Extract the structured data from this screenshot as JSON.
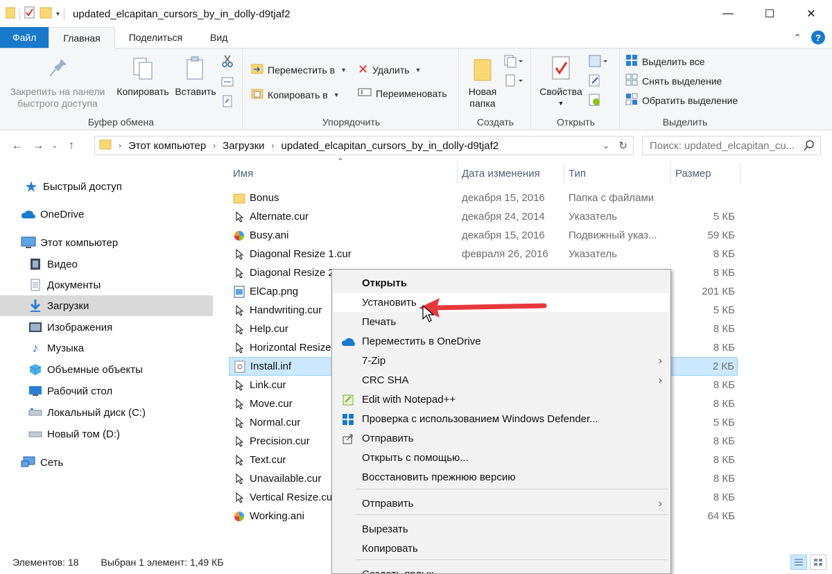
{
  "window": {
    "title": "updated_elcapitan_cursors_by_in_dolly-d9tjaf2",
    "buttons": {
      "minimize": "—",
      "maximize": "☐",
      "close": "✕"
    }
  },
  "ribbon_tabs": [
    "Файл",
    "Главная",
    "Поделиться",
    "Вид"
  ],
  "ribbon": {
    "clipboard": {
      "label": "Буфер обмена",
      "pin_line1": "Закрепить на панели",
      "pin_line2": "быстрого доступа",
      "copy": "Копировать",
      "paste": "Вставить"
    },
    "organize": {
      "label": "Упорядочить",
      "move_to": "Переместить в",
      "copy_to": "Копировать в",
      "delete": "Удалить",
      "rename": "Переименовать"
    },
    "new": {
      "label": "Создать",
      "new_folder_line1": "Новая",
      "new_folder_line2": "папка"
    },
    "open": {
      "label": "Открыть",
      "properties": "Свойства"
    },
    "select": {
      "label": "Выделить",
      "select_all": "Выделить все",
      "select_none": "Снять выделение",
      "invert": "Обратить выделение"
    }
  },
  "address": {
    "crumbs": [
      "Этот компьютер",
      "Загрузки",
      "updated_elcapitan_cursors_by_in_dolly-d9tjaf2"
    ],
    "search_placeholder": "Поиск: updated_elcapitan_cu..."
  },
  "sidebar": [
    {
      "label": "Быстрый доступ",
      "icon": "star-icon"
    },
    {
      "label": "OneDrive",
      "icon": "cloud-icon"
    },
    {
      "label": "Этот компьютер",
      "icon": "computer-icon"
    },
    {
      "label": "Видео",
      "icon": "video-icon"
    },
    {
      "label": "Документы",
      "icon": "documents-icon"
    },
    {
      "label": "Загрузки",
      "icon": "download-icon",
      "selected": true
    },
    {
      "label": "Изображения",
      "icon": "pictures-icon"
    },
    {
      "label": "Музыка",
      "icon": "music-icon"
    },
    {
      "label": "Объемные объекты",
      "icon": "3d-objects-icon"
    },
    {
      "label": "Рабочий стол",
      "icon": "desktop-icon"
    },
    {
      "label": "Локальный диск (C:)",
      "icon": "drive-icon"
    },
    {
      "label": "Новый том (D:)",
      "icon": "drive-icon"
    },
    {
      "label": "Сеть",
      "icon": "network-icon"
    }
  ],
  "columns": {
    "name": "Имя",
    "date": "Дата изменения",
    "type": "Тип",
    "size": "Размер"
  },
  "files": [
    {
      "name": "Bonus",
      "date": "декабря 15, 2016",
      "type": "Папка с файлами",
      "size": "",
      "icon": "folder-icon"
    },
    {
      "name": "Alternate.cur",
      "date": "декабря 24, 2014",
      "type": "Указатель",
      "size": "5 КБ",
      "icon": "cursor-file-icon"
    },
    {
      "name": "Busy.ani",
      "date": "декабря 15, 2016",
      "type": "Подвижный указ...",
      "size": "59 КБ",
      "icon": "animated-cursor-icon"
    },
    {
      "name": "Diagonal Resize 1.cur",
      "date": "февраля 26, 2016",
      "type": "Указатель",
      "size": "8 КБ",
      "icon": "cursor-file-icon"
    },
    {
      "name": "Diagonal Resize 2",
      "date": "",
      "type": "",
      "size": "8 КБ",
      "icon": "cursor-file-icon"
    },
    {
      "name": "ElCap.png",
      "date": "",
      "type": "",
      "size": "201 КБ",
      "icon": "image-file-icon"
    },
    {
      "name": "Handwriting.cur",
      "date": "",
      "type": "",
      "size": "5 КБ",
      "icon": "cursor-file-icon"
    },
    {
      "name": "Help.cur",
      "date": "",
      "type": "",
      "size": "8 КБ",
      "icon": "cursor-file-icon"
    },
    {
      "name": "Horizontal Resize",
      "date": "",
      "type": "",
      "size": "8 КБ",
      "icon": "cursor-file-icon"
    },
    {
      "name": "Install.inf",
      "date": "",
      "type": "",
      "size": "2 КБ",
      "icon": "inf-file-icon",
      "selected": true
    },
    {
      "name": "Link.cur",
      "date": "",
      "type": "",
      "size": "8 КБ",
      "icon": "cursor-file-icon"
    },
    {
      "name": "Move.cur",
      "date": "",
      "type": "",
      "size": "8 КБ",
      "icon": "cursor-file-icon"
    },
    {
      "name": "Normal.cur",
      "date": "",
      "type": "",
      "size": "5 КБ",
      "icon": "cursor-file-icon"
    },
    {
      "name": "Precision.cur",
      "date": "",
      "type": "",
      "size": "8 КБ",
      "icon": "cursor-file-icon"
    },
    {
      "name": "Text.cur",
      "date": "",
      "type": "",
      "size": "8 КБ",
      "icon": "cursor-file-icon"
    },
    {
      "name": "Unavailable.cur",
      "date": "",
      "type": "",
      "size": "8 КБ",
      "icon": "cursor-file-icon"
    },
    {
      "name": "Vertical Resize.cur",
      "date": "",
      "type": "",
      "size": "8 КБ",
      "icon": "cursor-file-icon"
    },
    {
      "name": "Working.ani",
      "date": "",
      "type": "",
      "size": "64 КБ",
      "icon": "animated-cursor-icon"
    }
  ],
  "status": {
    "count": "Элементов: 18",
    "selection": "Выбран 1 элемент: 1,49 КБ"
  },
  "context_menu": {
    "items": [
      {
        "label": "Открыть",
        "bold": true
      },
      {
        "label": "Установить",
        "highlighted": true
      },
      {
        "label": "Печать"
      },
      {
        "label": "Переместить в OneDrive",
        "icon": "onedrive-icon"
      },
      {
        "label": "7-Zip",
        "submenu": true
      },
      {
        "label": "CRC SHA",
        "submenu": true
      },
      {
        "label": "Edit with Notepad++",
        "icon": "notepadpp-icon"
      },
      {
        "label": "Проверка с использованием Windows Defender...",
        "icon": "defender-icon"
      },
      {
        "label": "Отправить",
        "icon": "share-icon"
      },
      {
        "label": "Открыть с помощью..."
      },
      {
        "label": "Восстановить прежнюю версию"
      },
      {
        "label": "Отправить",
        "submenu": true
      },
      {
        "label": "Вырезать"
      },
      {
        "label": "Копировать"
      },
      {
        "label": "Создать ярлык"
      }
    ]
  },
  "colors": {
    "accent": "#1979ca",
    "selection": "#cce8ff",
    "arrow": "#e8383d"
  }
}
